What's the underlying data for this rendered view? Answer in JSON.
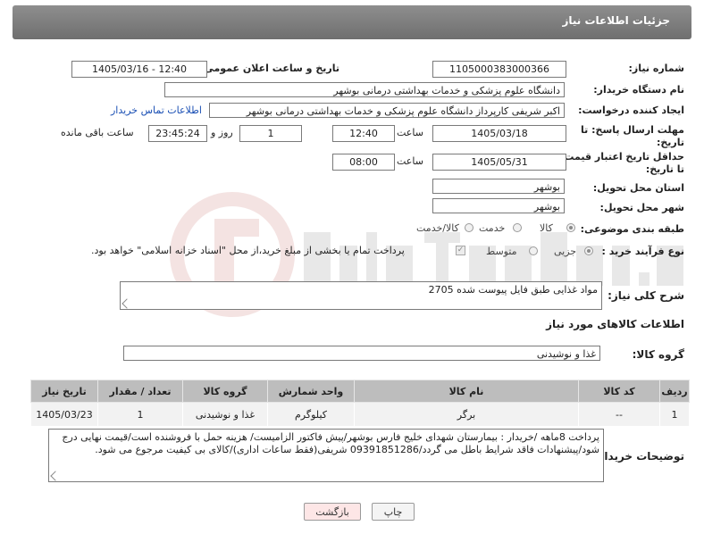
{
  "header": {
    "title": "جزئیات اطلاعات نیاز"
  },
  "form": {
    "need_number": {
      "label": "شماره نیاز:",
      "value": "1105000383000366"
    },
    "announce_datetime": {
      "label": "تاریخ و ساعت اعلان عمومی:",
      "value": "1405/03/16 - 12:40"
    },
    "buyer_org": {
      "label": "نام دستگاه خریدار:",
      "value": "دانشگاه علوم پزشکی و خدمات بهداشتی درمانی بوشهر"
    },
    "requester": {
      "label": "ایجاد کننده درخواست:",
      "value": "اکبر شریفی کارپرداز دانشگاه علوم پزشکی و خدمات بهداشتی درمانی بوشهر",
      "contact_link": "اطلاعات تماس خریدار"
    },
    "reply_deadline": {
      "label_line1": "مهلت ارسال پاسخ: تا",
      "label_line2": "تاریخ:",
      "date": "1405/03/18",
      "time_label": "ساعت",
      "time": "12:40",
      "days": "1",
      "days_label": "روز و",
      "remaining": "23:45:24",
      "remaining_label": "ساعت باقی مانده"
    },
    "price_validity": {
      "label_line1": "حداقل تاریخ اعتبار قیمت:",
      "label_line2": "تا تاریخ:",
      "date": "1405/05/31",
      "time_label": "ساعت",
      "time": "08:00"
    },
    "delivery_province": {
      "label": "استان محل تحویل:",
      "value": "بوشهر"
    },
    "delivery_city": {
      "label": "شهر محل تحویل:",
      "value": "بوشهر"
    },
    "category": {
      "label": "طبقه بندی موضوعی:",
      "options": [
        "کالا",
        "خدمت",
        "کالا/خدمت"
      ],
      "selected": "کالا"
    },
    "process_type": {
      "label": "نوع فرآیند خرید :",
      "options": [
        "جزیی",
        "متوسط"
      ],
      "selected": "جزیی",
      "payment_note": "پرداخت تمام یا بخشی از مبلغ خرید،از محل \"اسناد خزانه اسلامی\" خواهد بود."
    }
  },
  "description": {
    "label": "شرح کلی نیاز:",
    "value": "مواد غذایی طبق فایل پیوست شده 2705"
  },
  "goods_section": {
    "title": "اطلاعات کالاهای مورد نیاز"
  },
  "goods_group": {
    "label": "گروه کالا:",
    "value": "غذا و نوشیدنی"
  },
  "table": {
    "headers": [
      "ردیف",
      "کد کالا",
      "نام کالا",
      "واحد شمارش",
      "گروه کالا",
      "تعداد / مقدار",
      "تاریخ نیاز"
    ],
    "rows": [
      [
        "1",
        "--",
        "برگر",
        "کیلوگرم",
        "غذا و نوشیدنی",
        "1",
        "1405/03/23"
      ]
    ]
  },
  "buyer_notes": {
    "label": "توضیحات خریدار:",
    "value": "پرداخت 8ماهه /خریدار : بیمارستان شهدای خلیج فارس بوشهر/پیش فاکتور الزامیست/ هزینه حمل با فروشنده است/قیمت نهایی درج شود/پیشنهادات فاقد شرایط باطل می گردد/09391851286 شریفی(فقط ساعات اداری)/کالای بی کیفیت مرجوع می شود."
  },
  "buttons": {
    "print": "چاپ",
    "back": "بازگشت"
  },
  "colors": {
    "header": "#7f7f7f",
    "table_header": "#bdbdbd",
    "link": "#1a4fb4",
    "back_button": "#fde6e6"
  }
}
